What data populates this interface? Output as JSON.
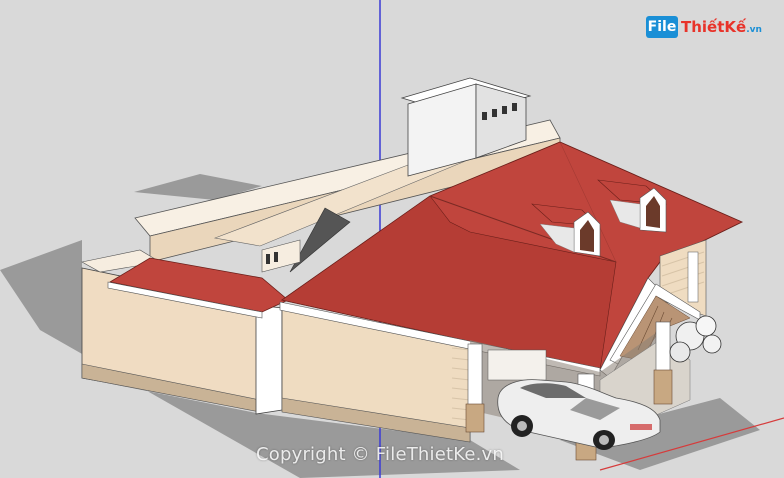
{
  "logo": {
    "badge": "File",
    "name": "ThiếtKế",
    "tld": ".vn"
  },
  "watermark": {
    "text": "Copyright © FileThietKe.vn"
  },
  "colors": {
    "roof": "#c0453d",
    "wall": "#f2e2cc",
    "sky": "#d9d9d9",
    "axis_blue": "#3b3bd6",
    "axis_red": "#d63b3b"
  }
}
